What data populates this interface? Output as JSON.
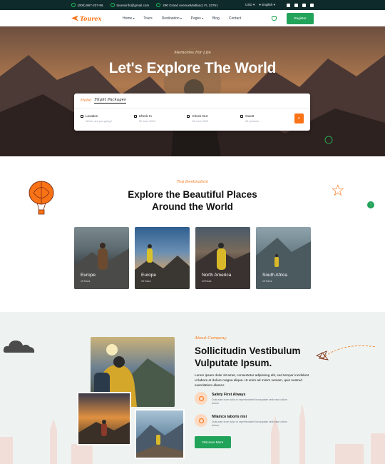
{
  "topbar": {
    "phone": "(000) 967-237-96",
    "email": "tourexinfo@gmail.com",
    "address": "290 Grand AvenueMaitland, FL 32751",
    "currency": "USD",
    "language": "English"
  },
  "nav": {
    "logo": "Tourex",
    "items": [
      "Home",
      "Tours",
      "Destination",
      "Pages",
      "Blog",
      "Contact"
    ],
    "register": "Register"
  },
  "hero": {
    "subtitle": "Memories For Life",
    "title": "Let's Explore The World"
  },
  "search": {
    "tab_hotel": "Hotel",
    "tab_flight": "Flight Packages",
    "fields": [
      {
        "label": "Location",
        "value": "Where are you going?"
      },
      {
        "label": "Check In",
        "value": "06 June 2024"
      },
      {
        "label": "Check Out",
        "value": "06 June 2024"
      },
      {
        "label": "Guest",
        "value": "03 persons"
      }
    ],
    "button_icon": "search-icon"
  },
  "destinations": {
    "subtitle": "Top Destination",
    "title_line1": "Explore the Beautiful Places",
    "title_line2": "Around the World",
    "cards": [
      {
        "name": "Europe",
        "meta": "10 Tours"
      },
      {
        "name": "Europe",
        "meta": "10 Tours"
      },
      {
        "name": "North America",
        "meta": "10 Tours"
      },
      {
        "name": "South Africa",
        "meta": "10 Tours"
      }
    ]
  },
  "about": {
    "subtitle": "About Company",
    "title": "Sollicitudin Vestibulum Vulputate Ipsum.",
    "text": "Lorem ipsum dolor sit amet, consectetur adipiscing elit, sed tempor incididunt ut labore et dolore magna aliqua. Ut enim ad minim veniam, quis nostrud exercitation ullamco",
    "features": [
      {
        "title": "Safety First Always",
        "desc": "Duis aute irure dolor in reprehenderit involuptate velit esse cillum dolore"
      },
      {
        "title": "Nllamco laboris nisi",
        "desc": "Duis aute irure dolor in reprehenderit involuptate velit esse cillum dolore"
      }
    ],
    "button": "Discover More"
  },
  "colors": {
    "accent": "#f97316",
    "green": "#22a35a",
    "topbar": "#0f2a2a"
  }
}
